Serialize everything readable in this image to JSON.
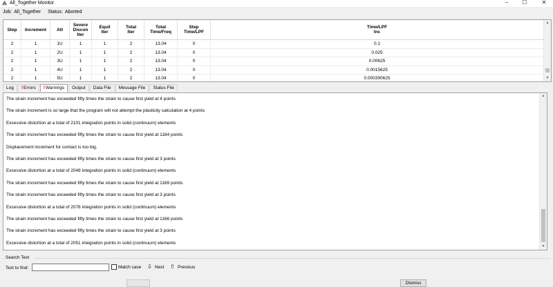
{
  "window": {
    "title": "All_Together Monitor",
    "minimize_glyph": "–",
    "maximize_glyph": "☐",
    "close_glyph": "✕"
  },
  "job": {
    "job_label": "Job:",
    "job_name": "All_Together",
    "status_label": "Status:",
    "status_value": "Aborted"
  },
  "grid": {
    "columns": [
      "Step",
      "Increment",
      "Att",
      "Severe\nDiscon\nIter",
      "Equil\nIter",
      "Total\nIter",
      "Total\nTime/Freq",
      "Step\nTime/LPF",
      "Time/LPF\nInc"
    ],
    "rows": [
      [
        "2",
        "1",
        "1U",
        "1",
        "1",
        "2",
        "13.04",
        "0",
        "0.1"
      ],
      [
        "2",
        "1",
        "2U",
        "1",
        "1",
        "2",
        "13.04",
        "0",
        "0.025"
      ],
      [
        "2",
        "1",
        "3U",
        "1",
        "1",
        "2",
        "13.04",
        "0",
        "0.00625"
      ],
      [
        "2",
        "1",
        "4U",
        "1",
        "1",
        "2",
        "13.04",
        "0",
        "0.0015625"
      ],
      [
        "2",
        "1",
        "5U",
        "1",
        "1",
        "2",
        "13.04",
        "0",
        "0.000390625"
      ]
    ]
  },
  "tabs": [
    {
      "label": "Log",
      "warn": ""
    },
    {
      "label": "Errors",
      "warn": "!"
    },
    {
      "label": "Warnings",
      "warn": "!"
    },
    {
      "label": "Output",
      "warn": ""
    },
    {
      "label": "Data File",
      "warn": ""
    },
    {
      "label": "Message File",
      "warn": ""
    },
    {
      "label": "Status File",
      "warn": ""
    }
  ],
  "active_tab": "Warnings",
  "log_lines": [
    "The strain increment has exceeded fifty times the strain to cause first yield at 4 points",
    "The strain increment is so large that the program will not attempt the plasticity calculation at 4 points",
    "Excessive distortion at a total of 2101 integration points in solid (continuum) elements",
    "The strain increment has exceeded fifty times the strain to cause first yield at 1184 points",
    "Displacement increment for contact is too big.",
    "The strain increment has exceeded fifty times the strain to cause first yield at 3 points",
    "Excessive distortion at a total of 2049 integration points in solid (continuum) elements",
    "The strain increment has exceeded fifty times the strain to cause first yield at 1169 points",
    "The strain increment has exceeded fifty times the strain to cause first yield at 3 points",
    "Excessive distortion at a total of 2078 integration points in solid (continuum) elements",
    "The strain increment has exceeded fifty times the strain to cause first yield at 1166 points",
    "The strain increment has exceeded fifty times the strain to cause first yield at 3 points",
    "Excessive distortion at a total of 2051 integration points in solid (continuum) elements"
  ],
  "search": {
    "group_label": "Search Text",
    "find_label": "Text to find:",
    "find_value": "",
    "match_case_label": "Match case",
    "next_label": "Next",
    "previous_label": "Previous",
    "next_glyph": "⇩",
    "previous_glyph": "⇧"
  },
  "footer": {
    "dismiss_label": "Dismiss"
  }
}
